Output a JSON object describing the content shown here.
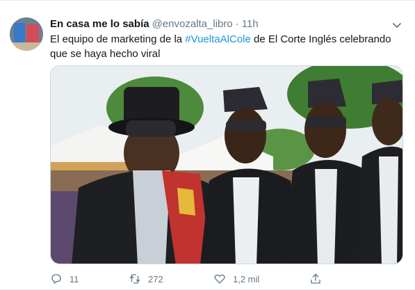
{
  "tweet": {
    "author_name": "En casa me lo sabía",
    "handle": "@envozalta_libro",
    "separator": "·",
    "time": "11h",
    "text_before": "El equipo de marketing de la ",
    "hashtag": "#VueltaAlCole",
    "text_after": " de El Corte Inglés celebrando que se haya hecho viral",
    "media_icon": "photo",
    "actions": {
      "reply_icon": "reply-icon",
      "reply_count": "11",
      "retweet_icon": "retweet-icon",
      "retweet_count": "272",
      "like_icon": "heart-icon",
      "like_count": "1,2 mil",
      "share_icon": "share-icon"
    }
  },
  "colors": {
    "hashtag": "#1b95e0",
    "secondary_text": "#657786",
    "primary_text": "#14171a"
  }
}
